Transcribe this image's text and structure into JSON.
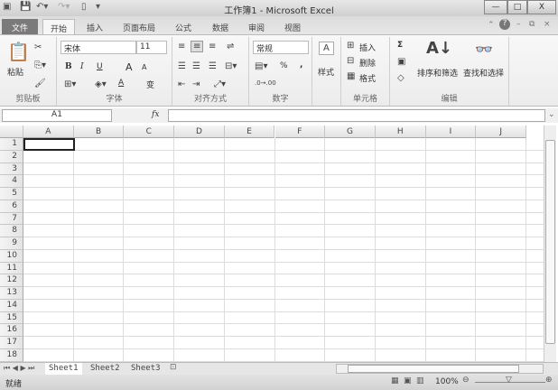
{
  "title": "工作簿1 - Microsoft Excel",
  "qat": {
    "app_icon": "excel-icon",
    "save": "save-icon",
    "undo": "undo-icon",
    "redo": "redo-icon",
    "new": "new-doc-icon",
    "customize": "dropdown-icon"
  },
  "window": {
    "minimize": "—",
    "restore": "□",
    "close": "X"
  },
  "tabs": [
    "文件",
    "开始",
    "插入",
    "页面布局",
    "公式",
    "数据",
    "审阅",
    "视图"
  ],
  "ribbon": {
    "clipboard": {
      "label": "剪贴板",
      "paste": "粘贴"
    },
    "font": {
      "label": "字体",
      "name": "宋体",
      "size": "11",
      "bold": "B",
      "italic": "I",
      "underline": "U",
      "grow": "A",
      "shrink": "A",
      "color": "A",
      "phonetic": "变"
    },
    "alignment": {
      "label": "对齐方式"
    },
    "number": {
      "label": "数字",
      "format": "常规",
      "percent": "%",
      "comma": ","
    },
    "styles": {
      "label": "样式"
    },
    "cells": {
      "label": "单元格",
      "insert": "插入",
      "delete": "删除",
      "format": "格式"
    },
    "editing": {
      "label": "编辑",
      "sum": "Σ",
      "sort": "排序和筛选",
      "find": "查找和选择"
    }
  },
  "formula_bar": {
    "name_box": "A1",
    "fx": "fx",
    "value": ""
  },
  "columns": [
    "A",
    "B",
    "C",
    "D",
    "E",
    "F",
    "G",
    "H",
    "I",
    "J"
  ],
  "rows": [
    "1",
    "2",
    "3",
    "4",
    "5",
    "6",
    "7",
    "8",
    "9",
    "10",
    "11",
    "12",
    "13",
    "14",
    "15",
    "16",
    "17",
    "18"
  ],
  "sheets": [
    "Sheet1",
    "Sheet2",
    "Sheet3"
  ],
  "status": {
    "text": "就绪",
    "zoom": "100%"
  }
}
